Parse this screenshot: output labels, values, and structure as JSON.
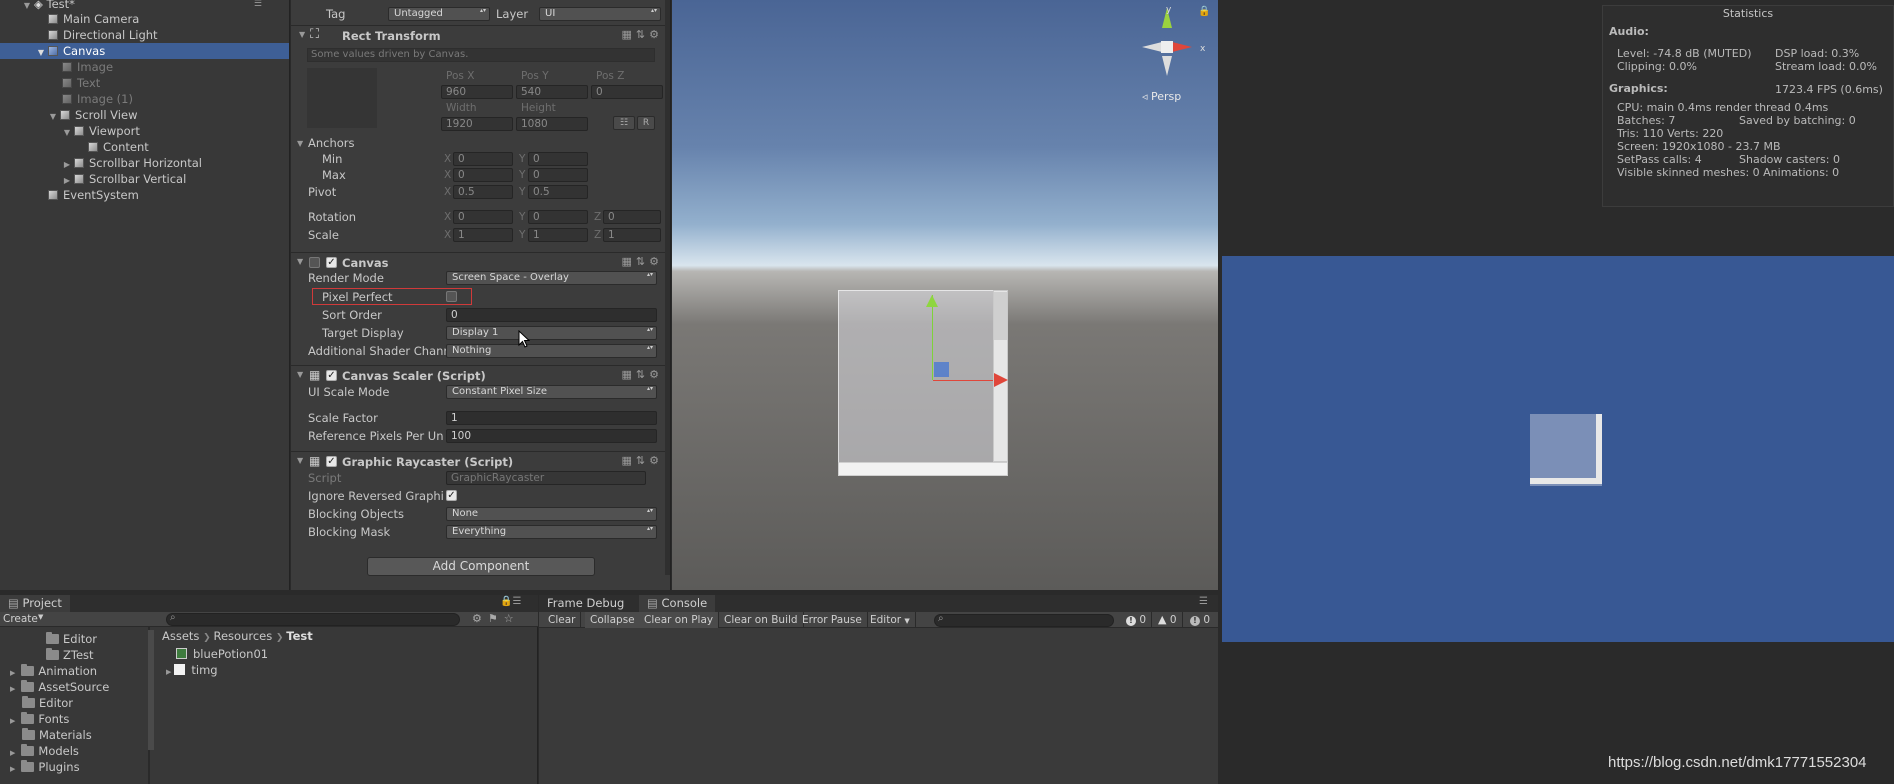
{
  "hierarchy": {
    "scene_name": "Test*",
    "items": [
      {
        "label": "Main Camera",
        "level": 1
      },
      {
        "label": "Directional Light",
        "level": 1
      },
      {
        "label": "Canvas",
        "level": 1
      },
      {
        "label": "Image",
        "level": 2
      },
      {
        "label": "Text",
        "level": 2
      },
      {
        "label": "Image (1)",
        "level": 2
      },
      {
        "label": "Scroll View",
        "level": 2
      },
      {
        "label": "Viewport",
        "level": 3
      },
      {
        "label": "Content",
        "level": 4
      },
      {
        "label": "Scrollbar Horizontal",
        "level": 3
      },
      {
        "label": "Scrollbar Vertical",
        "level": 3
      },
      {
        "label": "EventSystem",
        "level": 1
      }
    ]
  },
  "inspector": {
    "tag_label": "Tag",
    "tag_value": "Untagged",
    "layer_label": "Layer",
    "layer_value": "UI",
    "rect_transform": {
      "title": "Rect Transform",
      "note": "Some values driven by Canvas.",
      "pos_x_label": "Pos X",
      "pos_y_label": "Pos Y",
      "pos_z_label": "Pos Z",
      "pos_x": "960",
      "pos_y": "540",
      "pos_z": "0",
      "width_label": "Width",
      "height_label": "Height",
      "width": "1920",
      "height": "1080",
      "r_button": "R",
      "anchors_label": "Anchors",
      "min_label": "Min",
      "max_label": "Max",
      "min_x": "0",
      "min_y": "0",
      "max_x": "0",
      "max_y": "0",
      "pivot_label": "Pivot",
      "pivot_x": "0.5",
      "pivot_y": "0.5",
      "rotation_label": "Rotation",
      "rot_x": "0",
      "rot_y": "0",
      "rot_z": "0",
      "scale_label": "Scale",
      "scale_x": "1",
      "scale_y": "1",
      "scale_z": "1",
      "x": "X",
      "y": "Y",
      "z": "Z"
    },
    "canvas": {
      "title": "Canvas",
      "render_mode_label": "Render Mode",
      "render_mode": "Screen Space - Overlay",
      "pixel_perfect_label": "Pixel Perfect",
      "sort_order_label": "Sort Order",
      "sort_order": "0",
      "target_display_label": "Target Display",
      "target_display": "Display 1",
      "shader_channels_label": "Additional Shader Chann",
      "shader_channels": "Nothing"
    },
    "canvas_scaler": {
      "title": "Canvas Scaler (Script)",
      "ui_scale_mode_label": "UI Scale Mode",
      "ui_scale_mode": "Constant Pixel Size",
      "scale_factor_label": "Scale Factor",
      "scale_factor": "1",
      "ref_ppu_label": "Reference Pixels Per Un",
      "ref_ppu": "100"
    },
    "raycaster": {
      "title": "Graphic Raycaster (Script)",
      "script_label": "Script",
      "script_value": "GraphicRaycaster",
      "ignore_reversed_label": "Ignore Reversed Graphi",
      "blocking_objects_label": "Blocking Objects",
      "blocking_objects": "None",
      "blocking_mask_label": "Blocking Mask",
      "blocking_mask": "Everything"
    },
    "add_component": "Add Component"
  },
  "scene": {
    "persp_label": "◃ Persp"
  },
  "stats": {
    "title": "Statistics",
    "audio_label": "Audio:",
    "level": "Level: -74.8 dB (MUTED)",
    "dsp_load": "DSP load: 0.3%",
    "clipping": "Clipping: 0.0%",
    "stream_load": "Stream load: 0.0%",
    "graphics_label": "Graphics:",
    "fps": "1723.4 FPS (0.6ms)",
    "cpu": "CPU: main 0.4ms  render thread 0.4ms",
    "batches": "Batches: 7",
    "saved_batching": "Saved by batching: 0",
    "tris": "Tris: 110  Verts: 220",
    "screen": "Screen: 1920x1080 - 23.7 MB",
    "setpass": "SetPass calls: 4",
    "shadow_casters": "Shadow casters: 0",
    "skinned": "Visible skinned meshes: 0  Animations: 0"
  },
  "project": {
    "tab": "Project",
    "create": "Create",
    "breadcrumb": [
      "Assets",
      "Resources",
      "Test"
    ],
    "folders": [
      "Editor",
      "ZTest",
      "Animation",
      "AssetSource",
      "Editor",
      "Fonts",
      "Materials",
      "Models",
      "Plugins"
    ],
    "files": [
      "bluePotion01",
      "timg"
    ]
  },
  "console": {
    "tab_frame_debug": "Frame Debug",
    "tab_console": "Console",
    "buttons": [
      "Clear",
      "Collapse",
      "Clear on Play",
      "Clear on Build",
      "Error Pause",
      "Editor"
    ],
    "count_info": "0",
    "count_warn": "0",
    "count_error": "0"
  },
  "watermark": "https://blog.csdn.net/dmk17771552304",
  "colors": {
    "selection": "#3e5f96",
    "game_background": "#385894",
    "highlight_box": "#d03a3a"
  }
}
